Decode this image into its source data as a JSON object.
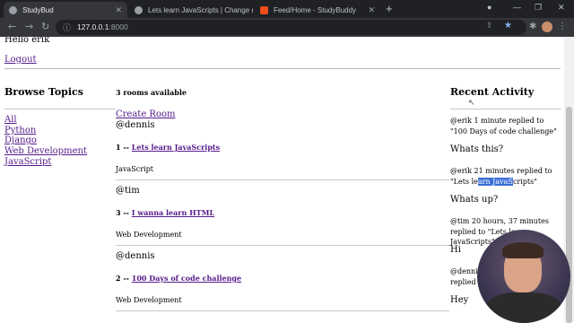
{
  "tabs": [
    {
      "title": "StudyBud",
      "active": true
    },
    {
      "title": "Lets learn JavaScripts | Change ro",
      "active": false
    },
    {
      "title": "Feed/Home - StudyBuddy",
      "active": false
    }
  ],
  "address": {
    "host": "127.0.0.1",
    "port": ":8000"
  },
  "greeting": "Hello erik",
  "logout": "Logout",
  "browse": {
    "title": "Browse Topics",
    "topics": [
      "All",
      "Python",
      "Django",
      "Web Development",
      "JavaScript"
    ]
  },
  "rooms": {
    "count_label": "3 rooms available",
    "create_label": "Create Room",
    "items": [
      {
        "host": "@dennis",
        "number": "1 --",
        "name": "Lets learn JavaScripts",
        "topic": "JavaScript"
      },
      {
        "host": "@tim",
        "number": "3 --",
        "name": "I wanna learn HTML",
        "topic": "Web Development"
      },
      {
        "host": "@dennis",
        "number": "2 --",
        "name": "100 Days of code challenge",
        "topic": "Web Development"
      }
    ]
  },
  "recent": {
    "title": "Recent Activity",
    "items": [
      {
        "meta_before_sel": "@erik 1 minute replied to \"100 Days of code challenge\"",
        "sel": "",
        "meta_after_sel": "",
        "message": "Whats this?"
      },
      {
        "meta_before_sel": "@erik 21 minutes replied to \"Lets le",
        "sel": "arn JavaS",
        "meta_after_sel": "cripts\"",
        "message": "Whats up?"
      },
      {
        "meta_before_sel": "@tim 20 hours, 37 minutes replied to \"Lets learn JavaScripts\"",
        "sel": "",
        "meta_after_sel": "",
        "message": "Hi"
      },
      {
        "meta_before_sel": "@dennis",
        "sel": "",
        "meta_after_sel": "",
        "meta_line2": "replied to",
        "message": "Hey"
      }
    ]
  },
  "icons": {
    "back": "back-arrow-icon",
    "forward": "forward-arrow-icon",
    "reload": "reload-icon",
    "info": "site-info-icon",
    "share": "share-icon",
    "star": "bookmark-star-icon",
    "extensions": "extensions-icon",
    "menu": "kebab-menu-icon"
  },
  "colors": {
    "link": "#551a8b",
    "selection": "#3a6fd8",
    "chrome_dark": "#202124",
    "chrome_toolbar": "#35363a"
  }
}
